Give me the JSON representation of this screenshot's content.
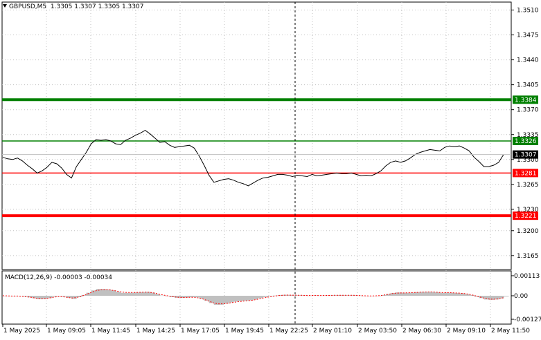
{
  "header": {
    "symbol": "GBPUSD,M5",
    "ohlc": "1.3305 1.3307 1.3305 1.3307"
  },
  "macd": {
    "label": "MACD(12,26,9) -0.00003 -0.00034",
    "ticks": [
      "0.00113",
      "0.00",
      "-0.00127"
    ]
  },
  "colors": {
    "background": "#ffffff",
    "grid": "#c0c0c0",
    "price_line": "#000000",
    "green_level": "#008000",
    "red_level": "#ff0000",
    "histogram": "#c0c0c0",
    "signal": "#ff0000"
  },
  "chart_data": {
    "type": "line",
    "title": "",
    "price_axis_ticks": [
      "1.3510",
      "1.3475",
      "1.3440",
      "1.3405",
      "1.3370",
      "1.3335",
      "1.3300",
      "1.3265",
      "1.3230",
      "1.3200",
      "1.3165"
    ],
    "ylim": [
      1.3158,
      1.3516
    ],
    "current_price": "1.3307",
    "levels": [
      {
        "label": "1.3384",
        "value": 1.3384,
        "color": "green",
        "style": "thick"
      },
      {
        "label": "1.3326",
        "value": 1.3326,
        "color": "green",
        "style": "thin"
      },
      {
        "label": "1.3281",
        "value": 1.3281,
        "color": "red",
        "style": "thin"
      },
      {
        "label": "1.3221",
        "value": 1.3221,
        "color": "red",
        "style": "thick"
      }
    ],
    "x_labels": [
      "1 May 2025",
      "1 May 09:05",
      "1 May 11:45",
      "1 May 14:25",
      "1 May 17:05",
      "1 May 19:45",
      "1 May 22:25",
      "2 May 01:10",
      "2 May 03:50",
      "2 May 06:30",
      "2 May 09:10",
      "2 May 11:50"
    ],
    "series": [
      {
        "values": [
          1.3303,
          1.3301,
          1.33,
          1.3302,
          1.3298,
          1.3292,
          1.3287,
          1.3281,
          1.3284,
          1.3289,
          1.3296,
          1.3294,
          1.3288,
          1.3279,
          1.3274,
          1.329,
          1.33,
          1.331,
          1.3322,
          1.3328,
          1.3327,
          1.3328,
          1.3326,
          1.3322,
          1.3321,
          1.3327,
          1.333,
          1.3334,
          1.3337,
          1.3341,
          1.3336,
          1.333,
          1.3324,
          1.3325,
          1.332,
          1.3317,
          1.3318,
          1.3319,
          1.332,
          1.3316,
          1.3305,
          1.3292,
          1.3278,
          1.3268,
          1.327,
          1.3272,
          1.3273,
          1.3271,
          1.3268,
          1.3266,
          1.3263,
          1.3267,
          1.3271,
          1.3274,
          1.3275,
          1.3277,
          1.3279,
          1.3279,
          1.3278,
          1.3276,
          1.3278,
          1.3277,
          1.3276,
          1.3279,
          1.3277,
          1.3278,
          1.3279,
          1.328,
          1.3281,
          1.328,
          1.328,
          1.3281,
          1.3279,
          1.3277,
          1.3278,
          1.3277,
          1.328,
          1.3284,
          1.3291,
          1.3296,
          1.3298,
          1.3296,
          1.3298,
          1.3302,
          1.3307,
          1.331,
          1.3312,
          1.3314,
          1.3313,
          1.3312,
          1.3317,
          1.3319,
          1.3318,
          1.3319,
          1.3316,
          1.3312,
          1.3303,
          1.3297,
          1.329,
          1.329,
          1.3292,
          1.3296,
          1.3307
        ]
      }
    ]
  }
}
